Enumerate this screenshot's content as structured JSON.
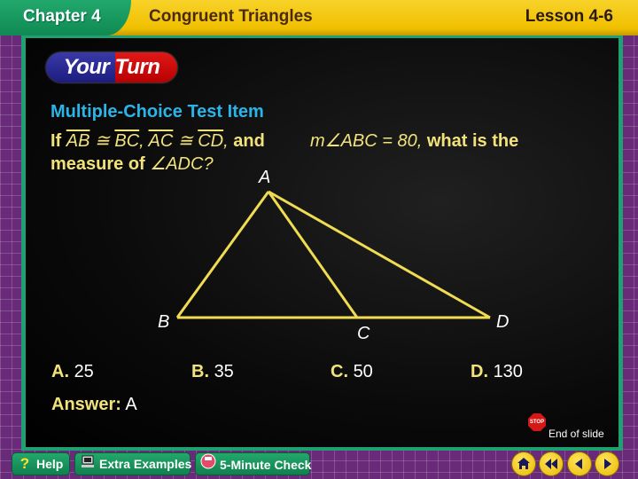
{
  "header": {
    "chapter": "Chapter 4",
    "title": "Congruent Triangles",
    "lesson": "Lesson 4-6"
  },
  "badge": "Your Turn",
  "question": {
    "heading": "Multiple-Choice Test Item",
    "if": "If",
    "seg1a": "AB",
    "seg1b": "BC",
    "seg2a": "AC",
    "seg2b": "CD",
    "cong": "≅",
    "comma": ",",
    "and": "and",
    "angle_given": "m∠ABC = 80,",
    "what": "what is the",
    "measure_of": "measure of",
    "angle_asked": "∠ADC?"
  },
  "figure": {
    "labels": {
      "A": "A",
      "B": "B",
      "C": "C",
      "D": "D"
    }
  },
  "choices": [
    {
      "key": "A.",
      "value": "25"
    },
    {
      "key": "B.",
      "value": "35"
    },
    {
      "key": "C.",
      "value": "50"
    },
    {
      "key": "D.",
      "value": "130"
    }
  ],
  "answer": {
    "label": "Answer:",
    "value": "A"
  },
  "end_of_slide": {
    "stop_text": "STOP",
    "label": "End of slide"
  },
  "footer": {
    "help": "Help",
    "extra_examples": "Extra Examples",
    "five_minute_check": "5-Minute Check"
  },
  "colors": {
    "accent_yellow": "#f2e27a",
    "heading_blue": "#29b5e8",
    "frame_green": "#1fa070"
  }
}
